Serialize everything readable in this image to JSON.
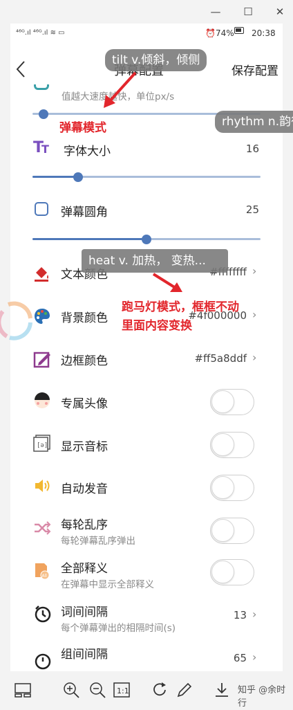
{
  "window": {
    "minimize": "—",
    "maximize": "☐",
    "close": "✕"
  },
  "status_bar": {
    "left": "⁴⁶ᴳ.ıl ⁴⁶ᴳ.ıl ≋ ▭",
    "battery": "⏰74%",
    "time": "20:38"
  },
  "header": {
    "title": "弹幕配置",
    "save_label": "保存配置"
  },
  "rows": {
    "speed": {
      "sub": "值越大速度越快，单位px/s",
      "slider_fraction": 0.04
    },
    "font_size": {
      "label": "字体大小",
      "value": "16",
      "slider_fraction": 0.2
    },
    "radius": {
      "label": "弹幕圆角",
      "value": "25",
      "slider_fraction": 0.5
    },
    "text_color": {
      "label": "文本颜色",
      "value": "#ffffffff"
    },
    "bg_color": {
      "label": "背景颜色",
      "value": "#4f000000"
    },
    "border_color": {
      "label": "边框颜色",
      "value": "#ff5a8ddf"
    },
    "avatar": {
      "label": "专属头像",
      "on": false
    },
    "phonetic": {
      "label": "显示音标",
      "on": false
    },
    "autoplay": {
      "label": "自动发音",
      "on": false
    },
    "shuffle": {
      "label": "每轮乱序",
      "sub": "每轮弹幕乱序弹出",
      "on": false
    },
    "full_def": {
      "label": "全部释义",
      "sub": "在弹幕中显示全部释义",
      "on": false
    },
    "word_interval": {
      "label": "词间间隔",
      "sub": "每个弹幕弹出的相隔时间(s)",
      "value": "13"
    },
    "group_interval": {
      "label": "组间间隔",
      "value": "65"
    }
  },
  "overlays": {
    "bubble_tilt": "tilt v.倾斜，倾侧",
    "bubble_rhythm": "rhythm n.韵律",
    "bubble_heat": "heat v. 加热， 变热...",
    "annotation_mode": "弹幕模式",
    "annotation_marquee_1": "跑马灯模式，框框不动",
    "annotation_marquee_2": "里面内容变换"
  },
  "toolbar": {
    "watermark": "知乎 @余时行"
  },
  "colors": {
    "accent": "#4e78b9",
    "annotation": "#e2262c"
  }
}
